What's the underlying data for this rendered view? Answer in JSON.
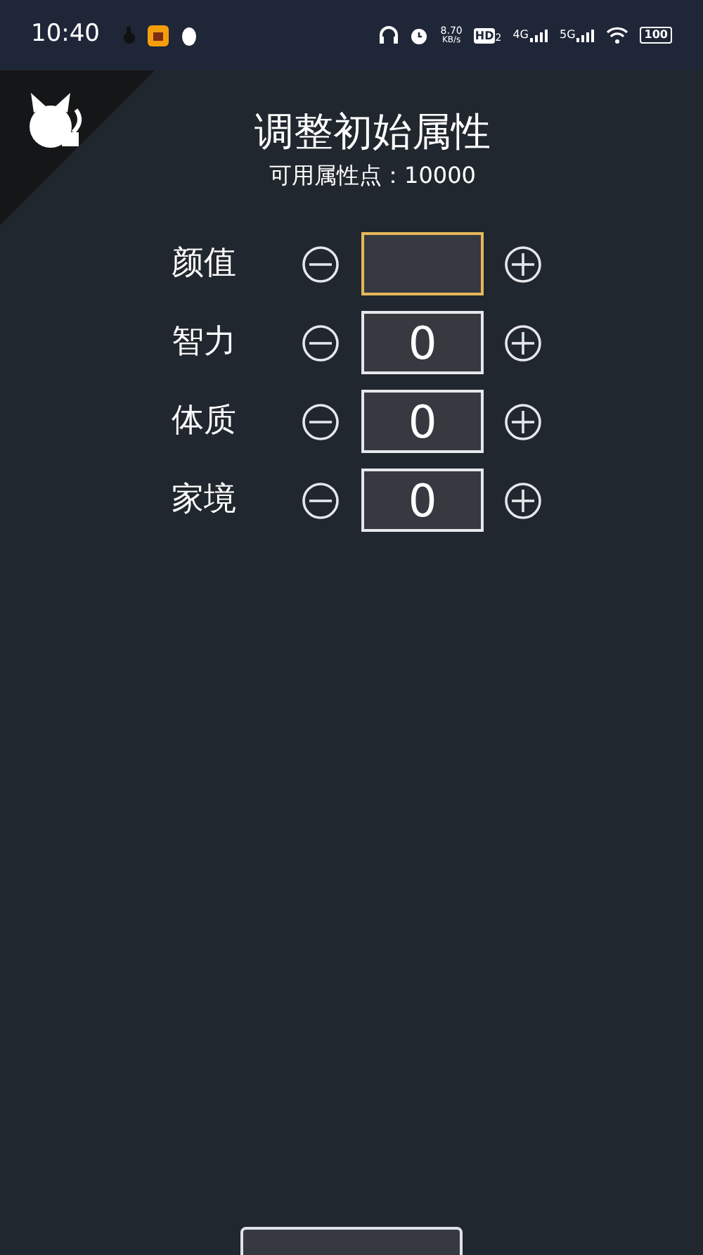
{
  "status_bar": {
    "time": "10:40",
    "net_speed": "8.70",
    "net_unit": "KB/s",
    "hd": "HD",
    "hd_sub": "2",
    "signal_1": "4G",
    "signal_2": "5G",
    "battery": "100"
  },
  "title": "调整初始属性",
  "points": "可用属性点：10000",
  "attributes": [
    {
      "label": "颜值",
      "focused": true
    },
    {
      "label": "智力",
      "value": "0",
      "focused": false
    },
    {
      "label": "体质",
      "value": "0",
      "focused": false
    },
    {
      "label": "家境",
      "value": "0",
      "focused": false
    }
  ]
}
